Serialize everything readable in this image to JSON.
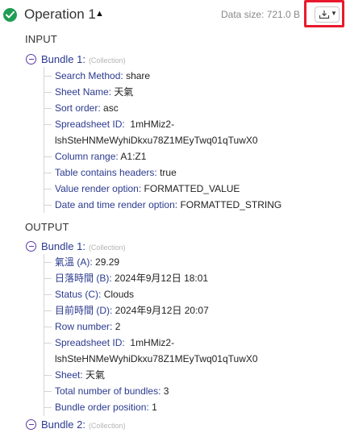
{
  "header": {
    "title": "Operation 1",
    "data_size": "Data size: 721.0 B",
    "status_icon": "check-circle-icon",
    "download_icon": "download-icon",
    "colors": {
      "success": "#1f9d55",
      "highlight": "#e8192c",
      "key": "#2b3a8f"
    }
  },
  "input": {
    "label": "INPUT",
    "bundle_label": "Bundle 1:",
    "collection_tag": "(Collection)",
    "rows": [
      {
        "key": "Search Method:",
        "value": "share"
      },
      {
        "key": "Sheet Name:",
        "value": "天氣"
      },
      {
        "key": "Sort order:",
        "value": "asc"
      },
      {
        "key": "Spreadsheet ID:",
        "value": "1mHMiz2-lshSteHNMeWyhiDkxu78Z1MEyTwq01qTuwX0"
      },
      {
        "key": "Column range:",
        "value": "A1:Z1"
      },
      {
        "key": "Table contains headers:",
        "value": "true"
      },
      {
        "key": "Value render option:",
        "value": "FORMATTED_VALUE"
      },
      {
        "key": "Date and time render option:",
        "value": "FORMATTED_STRING"
      }
    ]
  },
  "output": {
    "label": "OUTPUT",
    "bundles": [
      {
        "label": "Bundle 1:",
        "collection_tag": "(Collection)",
        "rows": [
          {
            "key": "氣溫 (A):",
            "value": "29.29"
          },
          {
            "key": "日落時間 (B):",
            "value": "2024年9月12日 18:01"
          },
          {
            "key": "Status (C):",
            "value": "Clouds"
          },
          {
            "key": "目前時間 (D):",
            "value": "2024年9月12日 20:07"
          },
          {
            "key": "Row number:",
            "value": "2"
          },
          {
            "key": "Spreadsheet ID:",
            "value": "1mHMiz2-lshSteHNMeWyhiDkxu78Z1MEyTwq01qTuwX0"
          },
          {
            "key": "Sheet:",
            "value": "天氣"
          },
          {
            "key": "Total number of bundles:",
            "value": "3"
          },
          {
            "key": "Bundle order position:",
            "value": "1"
          }
        ]
      },
      {
        "label": "Bundle 2:",
        "collection_tag": "(Collection)"
      }
    ]
  }
}
